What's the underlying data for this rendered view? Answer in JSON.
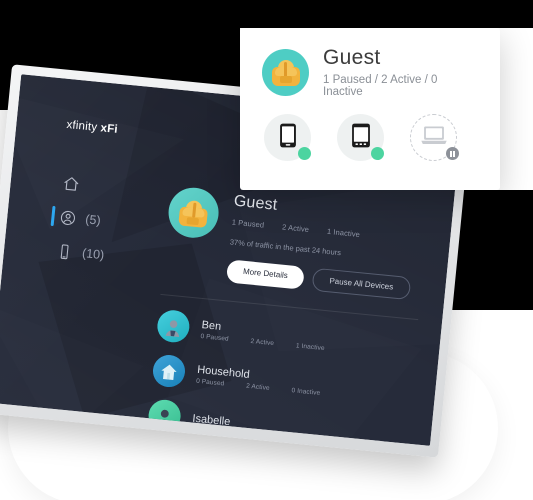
{
  "sidebar": {
    "brand_prefix": "xfinity ",
    "brand_suffix": "xFi",
    "items": [
      {
        "label": "",
        "icon": "home-icon",
        "count": ""
      },
      {
        "label": "",
        "icon": "person-icon",
        "count": "(5)"
      },
      {
        "label": "",
        "icon": "device-icon",
        "count": "(10)"
      }
    ],
    "active_index": 1,
    "accent_color": "#2da7f0"
  },
  "main": {
    "hero": {
      "avatar_icon": "backpack-icon",
      "name": "Guest",
      "stats": [
        "1 Paused",
        "2 Active",
        "1 Inactive"
      ],
      "traffic": "37% of traffic in the past 24 hours",
      "buttons": {
        "primary": "More Details",
        "secondary": "Pause All Devices"
      }
    },
    "profiles": [
      {
        "name": "Ben",
        "avatar_icon": "person-avatar-icon",
        "avatar_color": "#23c6d8",
        "stats": [
          "0 Paused",
          "2 Active",
          "1 Inactive"
        ]
      },
      {
        "name": "Household",
        "avatar_icon": "house-icon",
        "avatar_color": "#1b92d1",
        "stats": [
          "0 Paused",
          "2 Active",
          "0 Inactive"
        ]
      },
      {
        "name": "Isabelle",
        "avatar_icon": "person-avatar-icon",
        "avatar_color": "#3fd6a3",
        "stats": [
          "",
          "",
          ""
        ]
      }
    ]
  },
  "popup": {
    "avatar_icon": "backpack-icon",
    "name": "Guest",
    "summary": "1 Paused / 2 Active / 0 Inactive",
    "devices": [
      {
        "icon": "smartphone-icon",
        "status": "active"
      },
      {
        "icon": "tablet-icon",
        "status": "active"
      },
      {
        "icon": "laptop-icon",
        "status": "paused"
      }
    ]
  },
  "colors": {
    "screen_bg": "#262b3a",
    "accent_teal": "#4ecdc4",
    "active_green": "#4cd4a0",
    "paused_gray": "#8d9199",
    "bezel": "#e6e7e9"
  }
}
